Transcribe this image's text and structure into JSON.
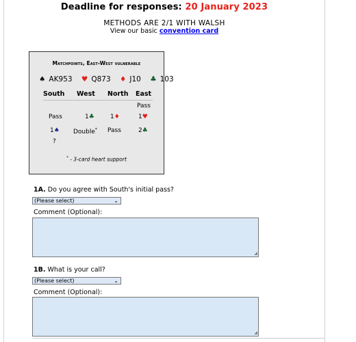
{
  "header": {
    "deadline_prefix": "Deadline for responses:",
    "deadline_date": "20 January 2023",
    "methods": "METHODS ARE 2/1 WITH WALSH",
    "basic_text": "View our basic",
    "convention_link": "convention card"
  },
  "problem": {
    "title": "Matchpoints, East-West vulnerable",
    "hand": {
      "spades": "AK953",
      "hearts": "Q873",
      "diamonds": "J10",
      "clubs": "103"
    },
    "auction_headers": [
      "South",
      "West",
      "North",
      "East"
    ],
    "east_first": "Pass",
    "row1": {
      "south": "Pass",
      "west": "1",
      "north": "1",
      "east": "1"
    },
    "row2": {
      "south": "1",
      "west": "Double",
      "west_mark": "*",
      "north": "Pass",
      "east": "2"
    },
    "row3": {
      "south": "?"
    },
    "footnote_mark": "*",
    "footnote": "- 3-card heart support"
  },
  "questions": [
    {
      "id": "1A.",
      "text": "Do you agree with South's initial pass?",
      "select": "(Please select)",
      "comment_label": "Comment (Optional):"
    },
    {
      "id": "1B.",
      "text": "What is your call?",
      "select": "(Please select)",
      "comment_label": "Comment (Optional):"
    }
  ],
  "colors": {
    "deadline_date": "#e8211b",
    "link": "#0000ee",
    "field_bg": "#d8e8f7",
    "box_bg": "#e8e8e8"
  }
}
